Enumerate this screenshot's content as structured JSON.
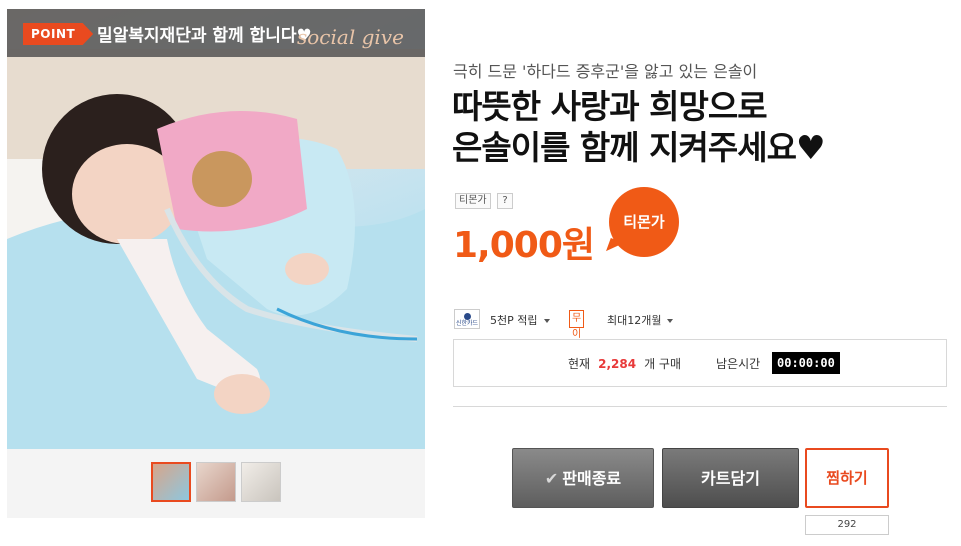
{
  "banner": {
    "badge": "POINT",
    "title": "밀알복지재단과 함께 합니다♥",
    "logo": "social give"
  },
  "thumbnails": [
    "thumbnail-1",
    "thumbnail-2",
    "thumbnail-3"
  ],
  "product": {
    "subtitle": "극히 드문 '하다드 증후군'을 앓고 있는 은솔이",
    "title_line1": "따뜻한 사랑과 희망으로",
    "title_line2": "은솔이를 함께 지켜주세요♥",
    "tprice_label": "티몬가",
    "tprice_help": "?",
    "price": "1,000원",
    "tprice_bubble": "티몬가"
  },
  "benefits": {
    "card_logo": "신한카드",
    "point": "5천P 적립",
    "no_interest_badge": "무이자",
    "installment": "최대12개월"
  },
  "status": {
    "now_label": "현재",
    "count": "2,284",
    "count_suffix": "개 구매",
    "remain_label": "남은시간",
    "timer": "00:00:00"
  },
  "buttons": {
    "sale_end": "판매종료",
    "cart": "카트담기",
    "wish": "찜하기",
    "wish_count": "292"
  },
  "colors": {
    "accent": "#f05a16",
    "count_red": "#e83a3a"
  }
}
